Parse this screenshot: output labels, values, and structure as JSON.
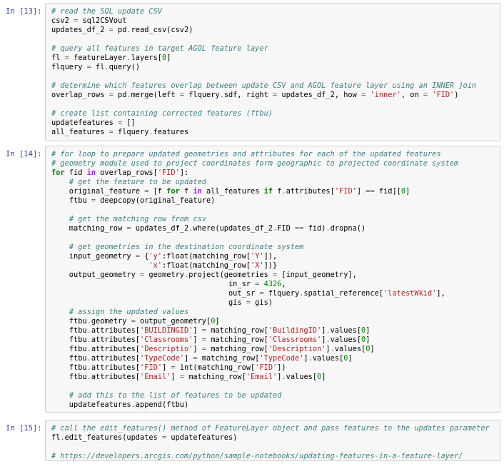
{
  "cells": [
    {
      "prompt": "In [13]:",
      "lines": [
        [
          {
            "t": "c",
            "v": "# read the SQL update CSV"
          }
        ],
        [
          {
            "t": "n",
            "v": "csv2 "
          },
          {
            "t": "o",
            "v": "="
          },
          {
            "t": "n",
            "v": " sql2CSVout"
          }
        ],
        [
          {
            "t": "n",
            "v": "updates_df_2 "
          },
          {
            "t": "o",
            "v": "="
          },
          {
            "t": "n",
            "v": " pd"
          },
          {
            "t": "o",
            "v": "."
          },
          {
            "t": "n",
            "v": "read_csv(csv2)"
          }
        ],
        [],
        [
          {
            "t": "c",
            "v": "# query all features in target AGOL feature layer"
          }
        ],
        [
          {
            "t": "n",
            "v": "fl "
          },
          {
            "t": "o",
            "v": "="
          },
          {
            "t": "n",
            "v": " featureLayer"
          },
          {
            "t": "o",
            "v": "."
          },
          {
            "t": "n",
            "v": "layers["
          },
          {
            "t": "m",
            "v": "0"
          },
          {
            "t": "n",
            "v": "]"
          }
        ],
        [
          {
            "t": "n",
            "v": "flquery "
          },
          {
            "t": "o",
            "v": "="
          },
          {
            "t": "n",
            "v": " fl"
          },
          {
            "t": "o",
            "v": "."
          },
          {
            "t": "n",
            "v": "query()"
          }
        ],
        [],
        [
          {
            "t": "c",
            "v": "# determine which features overlap between update CSV and AGOL feature layer using an INNER join"
          }
        ],
        [
          {
            "t": "n",
            "v": "overlap_rows "
          },
          {
            "t": "o",
            "v": "="
          },
          {
            "t": "n",
            "v": " pd"
          },
          {
            "t": "o",
            "v": "."
          },
          {
            "t": "n",
            "v": "merge(left "
          },
          {
            "t": "o",
            "v": "="
          },
          {
            "t": "n",
            "v": " flquery"
          },
          {
            "t": "o",
            "v": "."
          },
          {
            "t": "n",
            "v": "sdf, right "
          },
          {
            "t": "o",
            "v": "="
          },
          {
            "t": "n",
            "v": " updates_df_2, how "
          },
          {
            "t": "o",
            "v": "="
          },
          {
            "t": "n",
            "v": " "
          },
          {
            "t": "s",
            "v": "'inner'"
          },
          {
            "t": "n",
            "v": ", on "
          },
          {
            "t": "o",
            "v": "="
          },
          {
            "t": "n",
            "v": " "
          },
          {
            "t": "s",
            "v": "'FID'"
          },
          {
            "t": "n",
            "v": ")"
          }
        ],
        [],
        [
          {
            "t": "c",
            "v": "# create list containing corrected features (ftbu)"
          }
        ],
        [
          {
            "t": "n",
            "v": "updatefeatures "
          },
          {
            "t": "o",
            "v": "="
          },
          {
            "t": "n",
            "v": " []"
          }
        ],
        [
          {
            "t": "n",
            "v": "all_features "
          },
          {
            "t": "o",
            "v": "="
          },
          {
            "t": "n",
            "v": " flquery"
          },
          {
            "t": "o",
            "v": "."
          },
          {
            "t": "n",
            "v": "features"
          }
        ]
      ]
    },
    {
      "prompt": "In [14]:",
      "lines": [
        [
          {
            "t": "c",
            "v": "# for loop to prepare updated geometries and attributes for each of the updated features"
          }
        ],
        [
          {
            "t": "c",
            "v": "# geometry module used to project coordinates form geographic to projected coordinate system"
          }
        ],
        [
          {
            "t": "k",
            "v": "for"
          },
          {
            "t": "n",
            "v": " fid "
          },
          {
            "t": "ow",
            "v": "in"
          },
          {
            "t": "n",
            "v": " overlap_rows["
          },
          {
            "t": "s",
            "v": "'FID'"
          },
          {
            "t": "n",
            "v": "]:"
          }
        ],
        [
          {
            "t": "n",
            "v": "    "
          },
          {
            "t": "c",
            "v": "# get the feature to be updated"
          }
        ],
        [
          {
            "t": "n",
            "v": "    original_feature "
          },
          {
            "t": "o",
            "v": "="
          },
          {
            "t": "n",
            "v": " [f "
          },
          {
            "t": "k",
            "v": "for"
          },
          {
            "t": "n",
            "v": " f "
          },
          {
            "t": "ow",
            "v": "in"
          },
          {
            "t": "n",
            "v": " all_features "
          },
          {
            "t": "k",
            "v": "if"
          },
          {
            "t": "n",
            "v": " f"
          },
          {
            "t": "o",
            "v": "."
          },
          {
            "t": "n",
            "v": "attributes["
          },
          {
            "t": "s",
            "v": "'FID'"
          },
          {
            "t": "n",
            "v": "] "
          },
          {
            "t": "o",
            "v": "=="
          },
          {
            "t": "n",
            "v": " fid]["
          },
          {
            "t": "m",
            "v": "0"
          },
          {
            "t": "n",
            "v": "]"
          }
        ],
        [
          {
            "t": "n",
            "v": "    ftbu "
          },
          {
            "t": "o",
            "v": "="
          },
          {
            "t": "n",
            "v": " deepcopy(original_feature)"
          }
        ],
        [],
        [
          {
            "t": "n",
            "v": "    "
          },
          {
            "t": "c",
            "v": "# get the matching row from csv"
          }
        ],
        [
          {
            "t": "n",
            "v": "    matching_row "
          },
          {
            "t": "o",
            "v": "="
          },
          {
            "t": "n",
            "v": " updates_df_2"
          },
          {
            "t": "o",
            "v": "."
          },
          {
            "t": "n",
            "v": "where(updates_df_2"
          },
          {
            "t": "o",
            "v": "."
          },
          {
            "t": "n",
            "v": "FID "
          },
          {
            "t": "o",
            "v": "=="
          },
          {
            "t": "n",
            "v": " fid)"
          },
          {
            "t": "o",
            "v": "."
          },
          {
            "t": "n",
            "v": "dropna()"
          }
        ],
        [],
        [
          {
            "t": "n",
            "v": "    "
          },
          {
            "t": "c",
            "v": "# get geometries in the destination coordinate system"
          }
        ],
        [
          {
            "t": "n",
            "v": "    input_geometry "
          },
          {
            "t": "o",
            "v": "="
          },
          {
            "t": "n",
            "v": " {"
          },
          {
            "t": "s",
            "v": "'y'"
          },
          {
            "t": "n",
            "v": ":float(matching_row["
          },
          {
            "t": "s",
            "v": "'Y'"
          },
          {
            "t": "n",
            "v": "]),"
          }
        ],
        [
          {
            "t": "n",
            "v": "                      "
          },
          {
            "t": "s",
            "v": "'x'"
          },
          {
            "t": "n",
            "v": ":float(matching_row["
          },
          {
            "t": "s",
            "v": "'X'"
          },
          {
            "t": "n",
            "v": "])}"
          }
        ],
        [
          {
            "t": "n",
            "v": "    output_geometry "
          },
          {
            "t": "o",
            "v": "="
          },
          {
            "t": "n",
            "v": " geometry"
          },
          {
            "t": "o",
            "v": "."
          },
          {
            "t": "n",
            "v": "project(geometries "
          },
          {
            "t": "o",
            "v": "="
          },
          {
            "t": "n",
            "v": " [input_geometry],"
          }
        ],
        [
          {
            "t": "n",
            "v": "                                        in_sr "
          },
          {
            "t": "o",
            "v": "="
          },
          {
            "t": "n",
            "v": " "
          },
          {
            "t": "m",
            "v": "4326"
          },
          {
            "t": "n",
            "v": ","
          }
        ],
        [
          {
            "t": "n",
            "v": "                                        out_sr "
          },
          {
            "t": "o",
            "v": "="
          },
          {
            "t": "n",
            "v": " flquery"
          },
          {
            "t": "o",
            "v": "."
          },
          {
            "t": "n",
            "v": "spatial_reference["
          },
          {
            "t": "s",
            "v": "'latestWkid'"
          },
          {
            "t": "n",
            "v": "],"
          }
        ],
        [
          {
            "t": "n",
            "v": "                                        gis "
          },
          {
            "t": "o",
            "v": "="
          },
          {
            "t": "n",
            "v": " gis)"
          }
        ],
        [
          {
            "t": "n",
            "v": "    "
          },
          {
            "t": "c",
            "v": "# assign the updated values"
          }
        ],
        [
          {
            "t": "n",
            "v": "    ftbu"
          },
          {
            "t": "o",
            "v": "."
          },
          {
            "t": "n",
            "v": "geometry "
          },
          {
            "t": "o",
            "v": "="
          },
          {
            "t": "n",
            "v": " output_geometry["
          },
          {
            "t": "m",
            "v": "0"
          },
          {
            "t": "n",
            "v": "]"
          }
        ],
        [
          {
            "t": "n",
            "v": "    ftbu"
          },
          {
            "t": "o",
            "v": "."
          },
          {
            "t": "n",
            "v": "attributes["
          },
          {
            "t": "s",
            "v": "'BUILDINGID'"
          },
          {
            "t": "n",
            "v": "] "
          },
          {
            "t": "o",
            "v": "="
          },
          {
            "t": "n",
            "v": " matching_row["
          },
          {
            "t": "s",
            "v": "'BuildingID'"
          },
          {
            "t": "n",
            "v": "]"
          },
          {
            "t": "o",
            "v": "."
          },
          {
            "t": "n",
            "v": "values["
          },
          {
            "t": "m",
            "v": "0"
          },
          {
            "t": "n",
            "v": "]"
          }
        ],
        [
          {
            "t": "n",
            "v": "    ftbu"
          },
          {
            "t": "o",
            "v": "."
          },
          {
            "t": "n",
            "v": "attributes["
          },
          {
            "t": "s",
            "v": "'Classrooms'"
          },
          {
            "t": "n",
            "v": "] "
          },
          {
            "t": "o",
            "v": "="
          },
          {
            "t": "n",
            "v": " matching_row["
          },
          {
            "t": "s",
            "v": "'Classrooms'"
          },
          {
            "t": "n",
            "v": "]"
          },
          {
            "t": "o",
            "v": "."
          },
          {
            "t": "n",
            "v": "values["
          },
          {
            "t": "m",
            "v": "0"
          },
          {
            "t": "n",
            "v": "]"
          }
        ],
        [
          {
            "t": "n",
            "v": "    ftbu"
          },
          {
            "t": "o",
            "v": "."
          },
          {
            "t": "n",
            "v": "attributes["
          },
          {
            "t": "s",
            "v": "'Descriptio'"
          },
          {
            "t": "n",
            "v": "] "
          },
          {
            "t": "o",
            "v": "="
          },
          {
            "t": "n",
            "v": " matching_row["
          },
          {
            "t": "s",
            "v": "'Description'"
          },
          {
            "t": "n",
            "v": "]"
          },
          {
            "t": "o",
            "v": "."
          },
          {
            "t": "n",
            "v": "values["
          },
          {
            "t": "m",
            "v": "0"
          },
          {
            "t": "n",
            "v": "]"
          }
        ],
        [
          {
            "t": "n",
            "v": "    ftbu"
          },
          {
            "t": "o",
            "v": "."
          },
          {
            "t": "n",
            "v": "attributes["
          },
          {
            "t": "s",
            "v": "'TypeCode'"
          },
          {
            "t": "n",
            "v": "] "
          },
          {
            "t": "o",
            "v": "="
          },
          {
            "t": "n",
            "v": " matching_row["
          },
          {
            "t": "s",
            "v": "'TypeCode'"
          },
          {
            "t": "n",
            "v": "]"
          },
          {
            "t": "o",
            "v": "."
          },
          {
            "t": "n",
            "v": "values["
          },
          {
            "t": "m",
            "v": "0"
          },
          {
            "t": "n",
            "v": "]"
          }
        ],
        [
          {
            "t": "n",
            "v": "    ftbu"
          },
          {
            "t": "o",
            "v": "."
          },
          {
            "t": "n",
            "v": "attributes["
          },
          {
            "t": "s",
            "v": "'FID'"
          },
          {
            "t": "n",
            "v": "] "
          },
          {
            "t": "o",
            "v": "="
          },
          {
            "t": "n",
            "v": " int(matching_row["
          },
          {
            "t": "s",
            "v": "'FID'"
          },
          {
            "t": "n",
            "v": "])"
          }
        ],
        [
          {
            "t": "n",
            "v": "    ftbu"
          },
          {
            "t": "o",
            "v": "."
          },
          {
            "t": "n",
            "v": "attributes["
          },
          {
            "t": "s",
            "v": "'Email'"
          },
          {
            "t": "n",
            "v": "] "
          },
          {
            "t": "o",
            "v": "="
          },
          {
            "t": "n",
            "v": " matching_row["
          },
          {
            "t": "s",
            "v": "'Email'"
          },
          {
            "t": "n",
            "v": "]"
          },
          {
            "t": "o",
            "v": "."
          },
          {
            "t": "n",
            "v": "values["
          },
          {
            "t": "m",
            "v": "0"
          },
          {
            "t": "n",
            "v": "]"
          }
        ],
        [],
        [
          {
            "t": "n",
            "v": "    "
          },
          {
            "t": "c",
            "v": "# add this to the list of features to be updated"
          }
        ],
        [
          {
            "t": "n",
            "v": "    updatefeatures"
          },
          {
            "t": "o",
            "v": "."
          },
          {
            "t": "n",
            "v": "append(ftbu)"
          }
        ]
      ]
    },
    {
      "prompt": "In [15]:",
      "lines": [
        [
          {
            "t": "c",
            "v": "# call the edit_features() method of FeatureLayer object and pass features to the updates parameter"
          }
        ],
        [
          {
            "t": "n",
            "v": "fl"
          },
          {
            "t": "o",
            "v": "."
          },
          {
            "t": "n",
            "v": "edit_features(updates "
          },
          {
            "t": "o",
            "v": "="
          },
          {
            "t": "n",
            "v": " updatefeatures)"
          }
        ],
        [],
        [
          {
            "t": "c",
            "v": "# https://developers.arcgis.com/python/sample-notebooks/updating-features-in-a-feature-layer/"
          }
        ]
      ]
    }
  ]
}
